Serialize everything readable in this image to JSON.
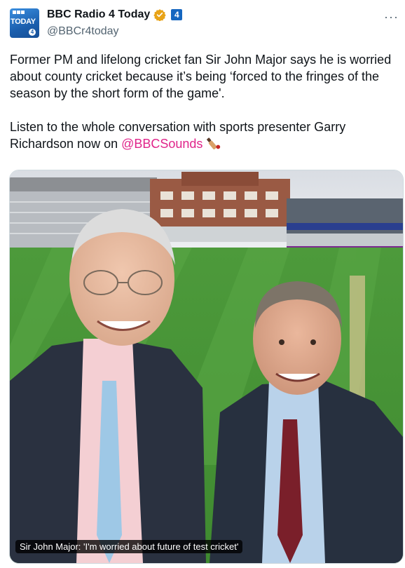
{
  "account": {
    "display_name": "BBC Radio 4 Today",
    "handle": "@BBCr4today",
    "avatar_text": "TODAY",
    "avatar_badge": "4",
    "affiliate_badge": "4"
  },
  "icons": {
    "verified": "verified-badge-icon",
    "more": "more-options-icon",
    "emoji": "cricket-bat-emoji-icon"
  },
  "tweet": {
    "paragraph1": "Former PM and lifelong cricket fan Sir John Major says he is worried about county cricket because it’s being ‘forced to the fringes of the season by the short form of the game'.",
    "paragraph2_text": "Listen to the whole conversation with sports presenter Garry Richardson now on ",
    "mention": "@BBCSounds"
  },
  "media": {
    "caption": "Sir John Major: 'I'm worried about future of test cricket'"
  },
  "colors": {
    "mention": "#e0248a",
    "verified": "#e8a317",
    "affiliate": "#1566c0",
    "secondary_text": "#536471"
  }
}
